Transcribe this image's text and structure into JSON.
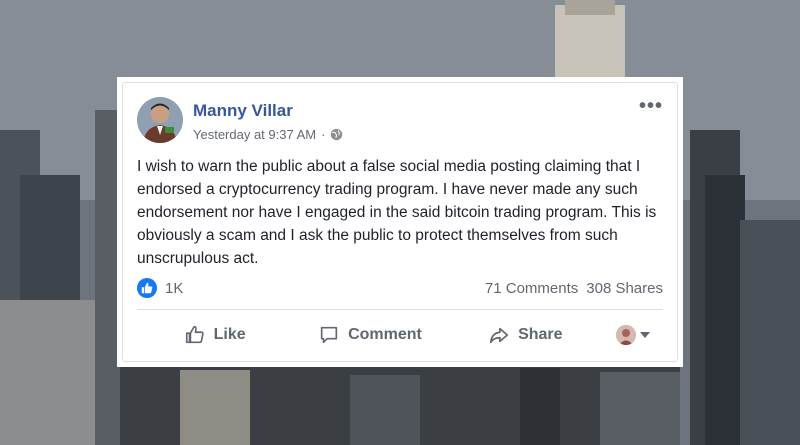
{
  "post": {
    "author": "Manny Villar",
    "timestamp": "Yesterday at 9:37 AM",
    "separator": "·",
    "privacy_icon": "globe-icon",
    "body": "I wish to warn the public about a false social media posting claiming that I endorsed a cryptocurrency trading program. I have never made any such endorsement nor have I engaged in the said bitcoin trading program. This is obviously a scam and I ask the public to protect themselves from such unscrupulous act.",
    "more_icon": "•••"
  },
  "stats": {
    "reactions": "1K",
    "comments": "71 Comments",
    "shares": "308 Shares"
  },
  "actions": {
    "like": "Like",
    "comment": "Comment",
    "share": "Share"
  },
  "colors": {
    "author": "#365899",
    "like_badge": "#1877f2",
    "muted": "#616770"
  }
}
